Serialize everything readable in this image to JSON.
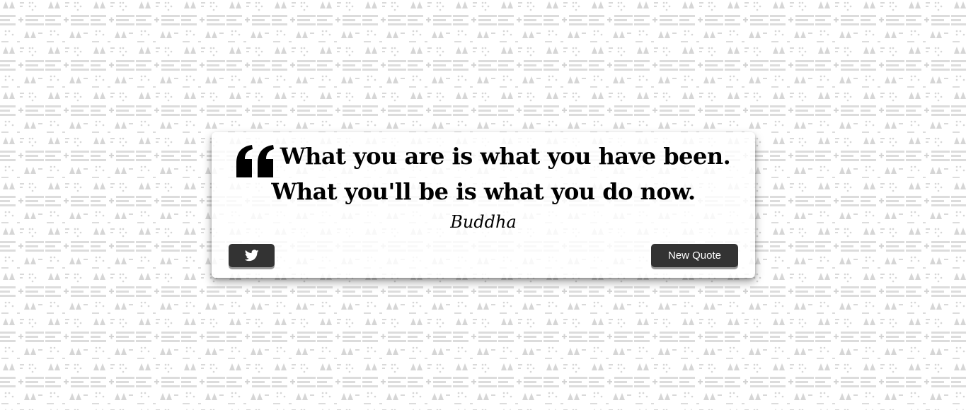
{
  "quote": {
    "text": "What you are is what you have been. What you'll be is what you do now.",
    "author": "Buddha"
  },
  "buttons": {
    "tweet_icon": "twitter-bird-icon",
    "new_quote_label": "New Quote"
  },
  "colors": {
    "button_bg": "#333333",
    "button_text": "#ffffff",
    "pattern": "#d9d9d9",
    "page_bg": "#ffffff"
  }
}
